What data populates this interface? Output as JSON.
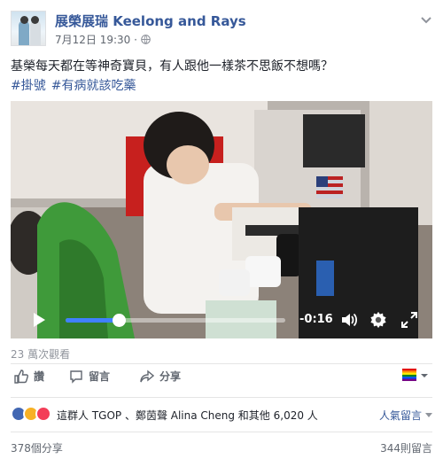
{
  "post": {
    "page_name": "展榮展瑞 Keelong and Rays",
    "date": "7月12日 19:30 ·",
    "text": "基榮每天都在等神奇寶貝，有人跟他一樣茶不思飯不想嗎？",
    "hashtags": [
      "#掛號",
      "#有病就該吃藥"
    ]
  },
  "video": {
    "progress": 0.24,
    "time_remaining": "-0:16"
  },
  "stats": {
    "views": "23 萬次觀看",
    "reactions_text": "這群人 TGOP 、鄭茵聲 Alina Cheng 和其他 6,020 人",
    "sort_label": "人氣留言",
    "shares": "378個分享",
    "comments": "344則留言"
  },
  "actions": {
    "like": "讚",
    "comment": "留言",
    "share": "分享"
  },
  "colors": {
    "link_blue": "#365899",
    "accent_blue": "#4080ff",
    "like_blue": "#4267b2",
    "haha_yellow": "#f7b125",
    "love_red": "#f33e58"
  },
  "icons": {
    "globe": "globe-icon",
    "like": "thumbs-up-icon",
    "comment": "speech-bubble-icon",
    "share": "share-arrow-icon",
    "play": "play-icon",
    "volume": "volume-icon",
    "settings": "gear-icon",
    "fullscreen": "fullscreen-icon"
  }
}
